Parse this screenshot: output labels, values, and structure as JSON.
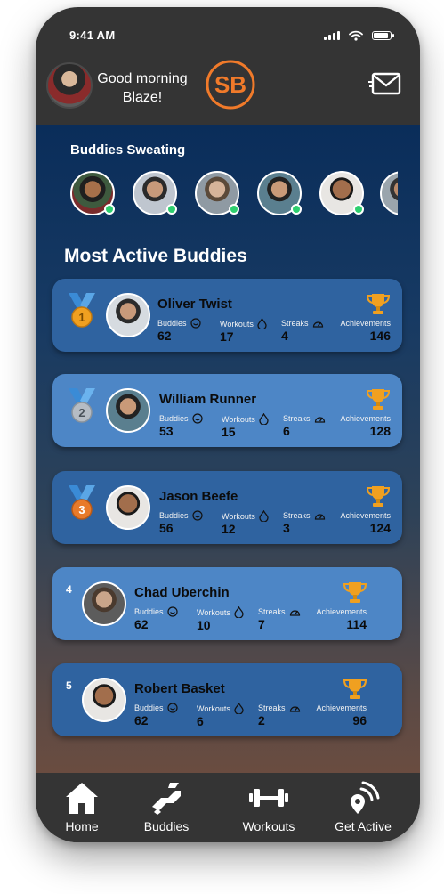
{
  "status_bar": {
    "time": "9:41 AM"
  },
  "header": {
    "greeting_line1": "Good morning",
    "greeting_line2": "Blaze!",
    "logo_text": "SB",
    "brand_color": "#f07a2a"
  },
  "buddies_section": {
    "title": "Buddies Sweating",
    "buddies": [
      {
        "online": true
      },
      {
        "online": true
      },
      {
        "online": true
      },
      {
        "online": true
      },
      {
        "online": true
      },
      {
        "online": false
      }
    ]
  },
  "leaderboard": {
    "title": "Most Active Buddies",
    "stat_labels": {
      "buddies": "Buddies",
      "workouts": "Workouts",
      "streaks": "Streaks",
      "achievements": "Achievements"
    },
    "entries": [
      {
        "rank": "1",
        "name": "Oliver Twist",
        "buddies": "62",
        "workouts": "17",
        "streaks": "4",
        "achievements": "146",
        "medal_color": "#f0a020"
      },
      {
        "rank": "2",
        "name": "William Runner",
        "buddies": "53",
        "workouts": "15",
        "streaks": "6",
        "achievements": "128",
        "medal_color": "#9aa4ae"
      },
      {
        "rank": "3",
        "name": "Jason Beefe",
        "buddies": "56",
        "workouts": "12",
        "streaks": "3",
        "achievements": "124",
        "medal_color": "#e87a2a"
      },
      {
        "rank": "4",
        "name": "Chad Uberchin",
        "buddies": "62",
        "workouts": "10",
        "streaks": "7",
        "achievements": "114"
      },
      {
        "rank": "5",
        "name": "Robert Basket",
        "buddies": "62",
        "workouts": "6",
        "streaks": "2",
        "achievements": "96"
      }
    ]
  },
  "tabbar": {
    "home": "Home",
    "buddies": "Buddies",
    "workouts": "Workouts",
    "get_active": "Get Active"
  },
  "colors": {
    "online": "#2ecf6f",
    "card_dark": "#2f63a0",
    "card_light": "#4d86c6",
    "trophy": "#f0a020"
  }
}
